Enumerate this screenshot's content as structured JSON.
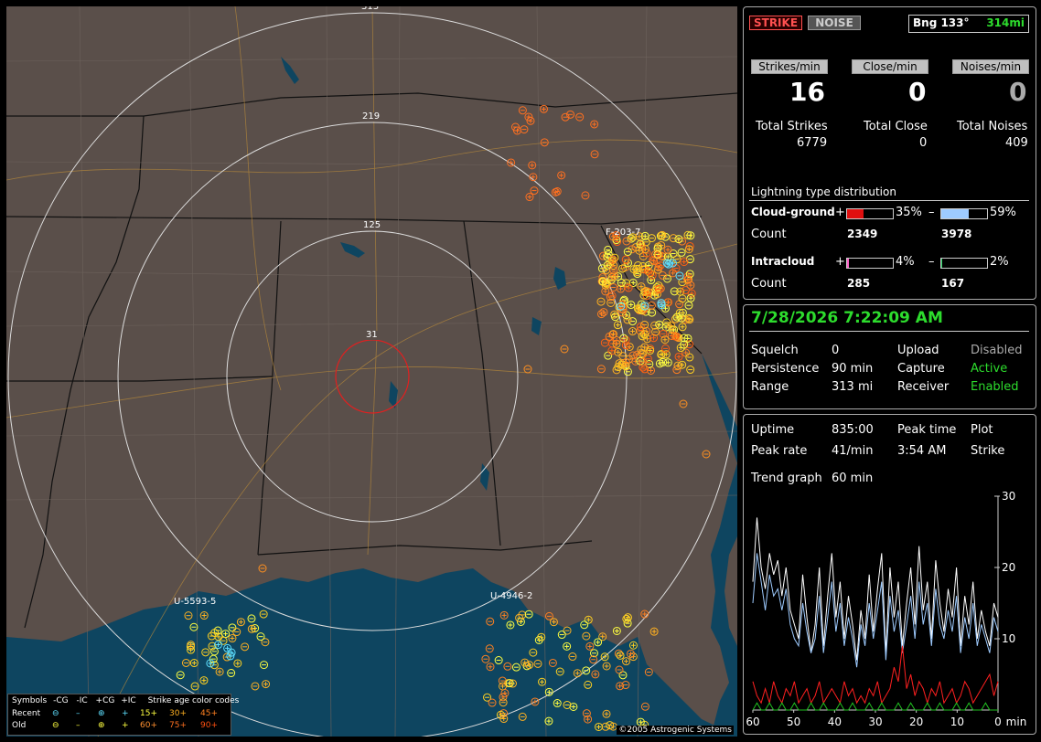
{
  "map": {
    "ring_labels": [
      "313",
      "219",
      "125",
      "31"
    ],
    "storm_labels": [
      "F-203-7",
      "U-5593-5",
      "U-4946-2"
    ],
    "copyright": "©2005 Astrogenic Systems",
    "legend": {
      "symbols_label": "Symbols",
      "cols": [
        "-CG",
        "-IC",
        "+CG",
        "+IC"
      ],
      "recent": "Recent",
      "old": "Old",
      "age_label": "Strike age color codes",
      "age_recent": [
        "15+",
        "30+",
        "45+"
      ],
      "age_old": [
        "60+",
        "75+",
        "90+"
      ]
    }
  },
  "header": {
    "strike_btn": "STRIKE",
    "noise_btn": "NOISE",
    "bearing": "Bng 133°",
    "distance": "314mi"
  },
  "rates": {
    "strikes_label": "Strikes/min",
    "close_label": "Close/min",
    "noises_label": "Noises/min",
    "strikes": "16",
    "close": "0",
    "noises": "0",
    "total_strikes_label": "Total Strikes",
    "total_close_label": "Total Close",
    "total_noises_label": "Total Noises",
    "total_strikes": "6779",
    "total_close": "0",
    "total_noises": "409"
  },
  "distribution": {
    "title": "Lightning type distribution",
    "cg_label": "Cloud-ground",
    "ic_label": "Intracloud",
    "count_label": "Count",
    "plus": "+",
    "minus": "–",
    "cg_pos_pct": "35%",
    "cg_neg_pct": "59%",
    "cg_pos_count": "2349",
    "cg_neg_count": "3978",
    "ic_pos_pct": "4%",
    "ic_neg_pct": "2%",
    "ic_pos_count": "285",
    "ic_neg_count": "167",
    "cg_pos_frac": 0.35,
    "cg_neg_frac": 0.59,
    "ic_pos_frac": 0.04,
    "ic_neg_frac": 0.02
  },
  "status": {
    "datetime": "7/28/2026 7:22:09 AM",
    "squelch_label": "Squelch",
    "squelch": "0",
    "persistence_label": "Persistence",
    "persistence": "90 min",
    "range_label": "Range",
    "range": "313 mi",
    "upload_label": "Upload",
    "upload": "Disabled",
    "capture_label": "Capture",
    "capture": "Active",
    "receiver_label": "Receiver",
    "receiver": "Enabled"
  },
  "stats": {
    "uptime_label": "Uptime",
    "uptime": "835:00",
    "peak_time_label": "Peak time",
    "plot_label": "Plot",
    "peak_rate_label": "Peak rate",
    "peak_rate": "41/min",
    "peak_time": "3:54 AM",
    "plot": "Strike",
    "trend_label": "Trend graph",
    "trend": "60 min"
  },
  "chart_data": {
    "type": "line",
    "xlabel": "min",
    "x_ticks": [
      "60",
      "50",
      "40",
      "30",
      "20",
      "10",
      "0"
    ],
    "y_ticks": [
      "30",
      "20",
      "10"
    ],
    "ylim": [
      0,
      30
    ],
    "xlim": [
      60,
      0
    ],
    "series": [
      {
        "color": "#ffffff",
        "values": [
          18,
          27,
          20,
          17,
          22,
          19,
          21,
          16,
          20,
          14,
          12,
          10,
          19,
          13,
          8,
          12,
          20,
          9,
          16,
          22,
          13,
          18,
          10,
          16,
          12,
          7,
          14,
          10,
          19,
          11,
          17,
          22,
          8,
          20,
          13,
          18,
          9,
          15,
          20,
          12,
          23,
          14,
          18,
          10,
          21,
          15,
          11,
          17,
          13,
          20,
          9,
          16,
          12,
          18,
          10,
          14,
          11,
          9,
          15,
          13
        ]
      },
      {
        "color": "#9ecbff",
        "values": [
          15,
          22,
          18,
          14,
          19,
          16,
          17,
          14,
          17,
          12,
          10,
          9,
          15,
          11,
          8,
          10,
          16,
          8,
          13,
          18,
          11,
          15,
          9,
          13,
          10,
          6,
          12,
          9,
          15,
          10,
          14,
          18,
          7,
          16,
          11,
          14,
          8,
          12,
          16,
          10,
          18,
          12,
          15,
          9,
          17,
          12,
          10,
          14,
          11,
          16,
          8,
          13,
          10,
          15,
          9,
          12,
          10,
          8,
          13,
          11
        ]
      },
      {
        "color": "#ff2020",
        "values": [
          4,
          2,
          1,
          3,
          1,
          4,
          2,
          1,
          3,
          2,
          4,
          1,
          2,
          3,
          1,
          2,
          4,
          1,
          2,
          3,
          2,
          1,
          4,
          2,
          3,
          1,
          2,
          1,
          3,
          2,
          4,
          1,
          2,
          3,
          6,
          4,
          9,
          3,
          5,
          2,
          4,
          3,
          1,
          3,
          2,
          4,
          1,
          2,
          3,
          1,
          2,
          4,
          3,
          1,
          2,
          3,
          4,
          5,
          2,
          4
        ]
      },
      {
        "color": "#20c020",
        "values": [
          0,
          1,
          0,
          0,
          1,
          0,
          0,
          1,
          0,
          0,
          1,
          0,
          0,
          0,
          1,
          0,
          0,
          1,
          0,
          0,
          0,
          1,
          0,
          0,
          1,
          0,
          0,
          0,
          1,
          0,
          0,
          1,
          0,
          0,
          0,
          1,
          0,
          0,
          1,
          0,
          0,
          0,
          1,
          0,
          0,
          1,
          0,
          0,
          0,
          1,
          0,
          0,
          1,
          0,
          0,
          0,
          1,
          0,
          0,
          0
        ]
      }
    ]
  }
}
